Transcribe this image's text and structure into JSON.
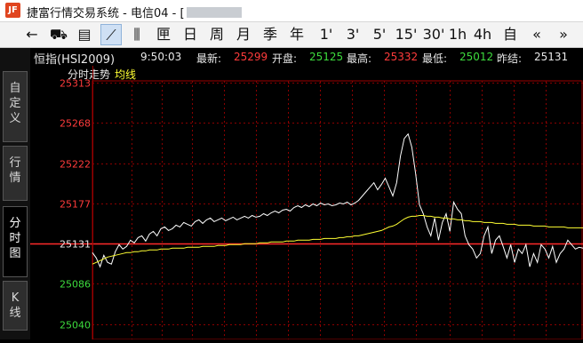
{
  "window": {
    "logo": "JF",
    "title": "捷富行情交易系统 - 电信04 - ["
  },
  "toolbar": {
    "buttons": [
      {
        "name": "back-arrow-icon",
        "label": "←"
      },
      {
        "name": "cart-icon",
        "label": "⛟"
      },
      {
        "name": "table-icon",
        "label": "▤"
      },
      {
        "name": "line-chart-icon",
        "label": "⟋"
      },
      {
        "name": "candlestick-icon",
        "label": "⫼"
      },
      {
        "name": "period-fenbi",
        "label": "匣"
      },
      {
        "name": "period-day",
        "label": "日"
      },
      {
        "name": "period-week",
        "label": "周"
      },
      {
        "name": "period-month",
        "label": "月"
      },
      {
        "name": "period-quarter",
        "label": "季"
      },
      {
        "name": "period-year",
        "label": "年"
      },
      {
        "name": "period-1min",
        "label": "1'"
      },
      {
        "name": "period-3min",
        "label": "3'"
      },
      {
        "name": "period-5min",
        "label": "5'"
      },
      {
        "name": "period-15min",
        "label": "15'"
      },
      {
        "name": "period-30min",
        "label": "30'"
      },
      {
        "name": "period-1h",
        "label": "1h"
      },
      {
        "name": "period-4h",
        "label": "4h"
      },
      {
        "name": "period-custom",
        "label": "自"
      },
      {
        "name": "prev-icon",
        "label": "«"
      },
      {
        "name": "next-icon",
        "label": "»"
      }
    ]
  },
  "sidebar": {
    "tabs": [
      {
        "label": "自\n定\n义",
        "active": false
      },
      {
        "label": "行\n情",
        "active": false
      },
      {
        "label": "分\n时\n图",
        "active": true
      },
      {
        "label": "K\n线",
        "active": false
      }
    ]
  },
  "quote": {
    "name": "恒指(HSI2009)",
    "time": "9:50:03",
    "latest_label": "最新:",
    "latest": "25299",
    "open_label": "开盘:",
    "open": "25125",
    "high_label": "最高:",
    "high": "25332",
    "low_label": "最低:",
    "low": "25012",
    "prev_close_label": "昨结:",
    "prev_close": "25131"
  },
  "chart_header": {
    "title": "分时走势",
    "avg_label": "均线"
  },
  "colors": {
    "up": "#ff3b3b",
    "down": "#3ddc3d",
    "grid": "#8b0000",
    "price_line": "#ffffff",
    "avg_line": "#ffff33"
  },
  "chart_data": {
    "type": "line",
    "y_ticks": [
      {
        "value": 25313,
        "label": "25313",
        "color": "up"
      },
      {
        "value": 25268,
        "label": "25268",
        "color": "up"
      },
      {
        "value": 25222,
        "label": "25222",
        "color": "up"
      },
      {
        "value": 25177,
        "label": "25177",
        "color": "up"
      },
      {
        "value": 25131,
        "label": "25131",
        "color": "neutral"
      },
      {
        "value": 25086,
        "label": "25086",
        "color": "down"
      },
      {
        "value": 25040,
        "label": "25040",
        "color": "down"
      }
    ],
    "ylim": [
      25020,
      25330
    ],
    "reference": 25131,
    "n_points": 130,
    "series": [
      {
        "name": "price",
        "color": "#ffffff",
        "values": [
          25121,
          25115,
          25105,
          25118,
          25110,
          25108,
          25122,
          25130,
          25125,
          25128,
          25135,
          25132,
          25138,
          25140,
          25134,
          25142,
          25145,
          25140,
          25148,
          25150,
          25146,
          25148,
          25152,
          25150,
          25155,
          25153,
          25151,
          25156,
          25158,
          25154,
          25158,
          25160,
          25156,
          25158,
          25160,
          25157,
          25159,
          25161,
          25158,
          25160,
          25162,
          25160,
          25163,
          25161,
          25162,
          25165,
          25163,
          25166,
          25168,
          25166,
          25169,
          25170,
          25168,
          25172,
          25174,
          25172,
          25175,
          25173,
          25176,
          25174,
          25177,
          25175,
          25176,
          25174,
          25175,
          25177,
          25176,
          25178,
          25175,
          25177,
          25180,
          25185,
          25190,
          25195,
          25200,
          25192,
          25198,
          25205,
          25195,
          25185,
          25200,
          25230,
          25250,
          25255,
          25240,
          25210,
          25175,
          25165,
          25150,
          25140,
          25160,
          25135,
          25155,
          25165,
          25145,
          25178,
          25170,
          25165,
          25140,
          25130,
          25125,
          25115,
          25120,
          25140,
          25150,
          25120,
          25135,
          25140,
          25128,
          25115,
          25130,
          25110,
          25125,
          25120,
          25130,
          25105,
          25120,
          25110,
          25130,
          25125,
          25115,
          25128,
          25110,
          25120,
          25125,
          25135,
          25130,
          25125,
          25127,
          25126
        ]
      },
      {
        "name": "avg",
        "color": "#ffff33",
        "values": [
          25108,
          25110,
          25112,
          25114,
          25116,
          25117,
          25118,
          25119,
          25120,
          25121,
          25121,
          25122,
          25122,
          25123,
          25123,
          25124,
          25124,
          25124,
          25125,
          25125,
          25125,
          25126,
          25126,
          25126,
          25126,
          25127,
          25127,
          25127,
          25127,
          25128,
          25128,
          25128,
          25128,
          25129,
          25129,
          25129,
          25130,
          25130,
          25130,
          25130,
          25131,
          25131,
          25131,
          25131,
          25132,
          25132,
          25132,
          25133,
          25133,
          25133,
          25133,
          25134,
          25134,
          25134,
          25135,
          25135,
          25135,
          25135,
          25136,
          25136,
          25136,
          25137,
          25137,
          25137,
          25137,
          25138,
          25138,
          25139,
          25139,
          25140,
          25140,
          25141,
          25142,
          25143,
          25144,
          25145,
          25146,
          25148,
          25150,
          25151,
          25153,
          25156,
          25159,
          25161,
          25162,
          25162,
          25163,
          25163,
          25162,
          25162,
          25161,
          25161,
          25160,
          25160,
          25159,
          25159,
          25158,
          25158,
          25157,
          25157,
          25156,
          25156,
          25156,
          25155,
          25155,
          25155,
          25154,
          25154,
          25154,
          25153,
          25153,
          25153,
          25152,
          25152,
          25152,
          25152,
          25151,
          25151,
          25151,
          25151,
          25150,
          25150,
          25150,
          25150,
          25150,
          25149,
          25149,
          25149,
          25149,
          25149
        ]
      }
    ]
  }
}
